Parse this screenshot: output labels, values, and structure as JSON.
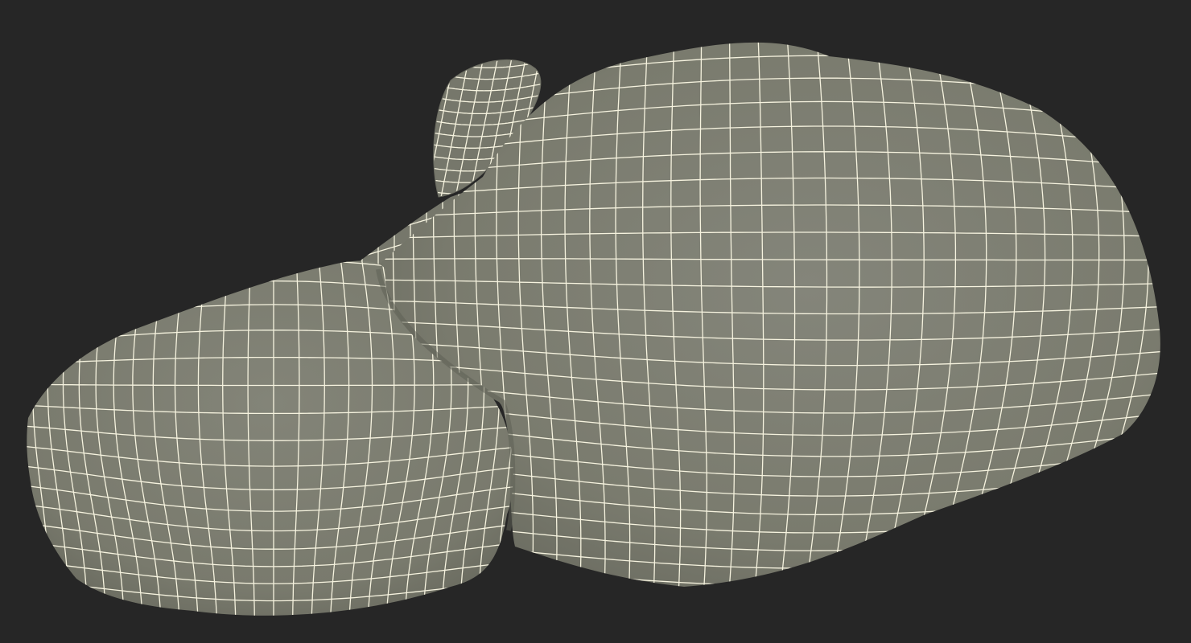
{
  "scene": {
    "subject": "wireframe-mesh-render",
    "colors": {
      "background": "#262626",
      "surface": "#7b7c6f",
      "surface_shade": "#6c6d61",
      "surface_light": "#85867a",
      "wire": "#f6f3df"
    }
  }
}
